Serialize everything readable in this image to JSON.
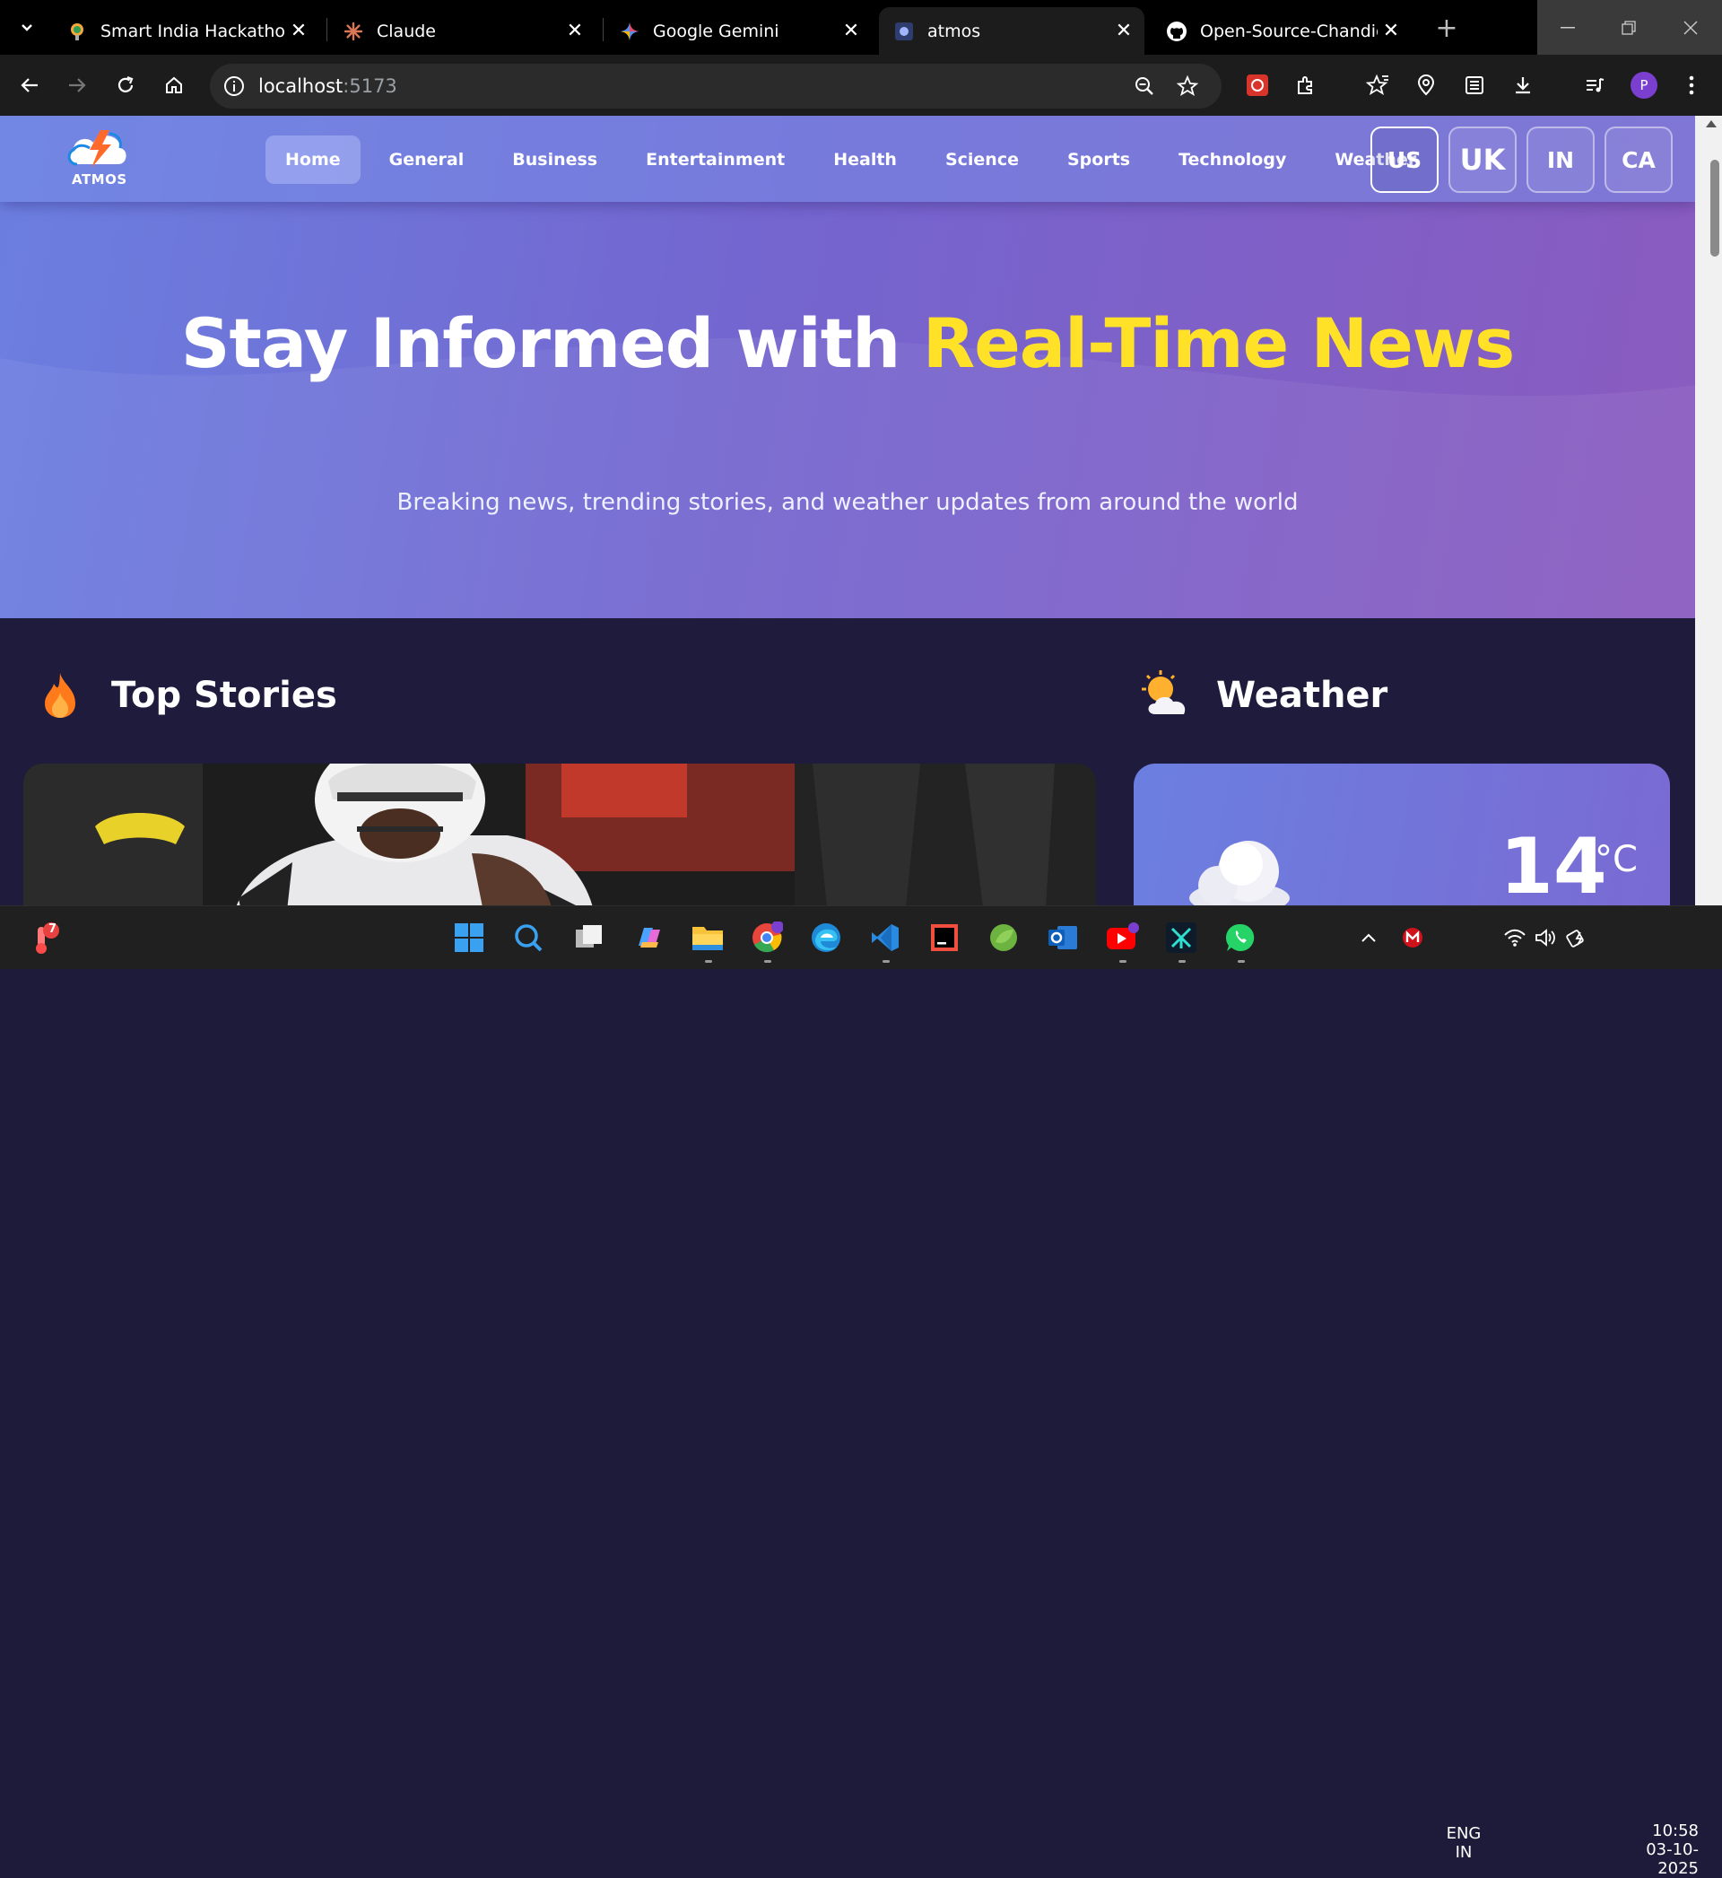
{
  "browser": {
    "tabs": [
      {
        "title": "Smart India Hackathon",
        "icon": "smart-india-hackathon-favicon"
      },
      {
        "title": "Claude",
        "icon": "claude-favicon"
      },
      {
        "title": "Google Gemini",
        "icon": "gemini-favicon"
      },
      {
        "title": "atmos",
        "icon": "atmos-favicon",
        "active": true
      },
      {
        "title": "Open-Source-Chandigarh",
        "icon": "github-favicon"
      }
    ],
    "address": {
      "host": "localhost",
      "port": ":5173"
    },
    "profile_initial": "P"
  },
  "site": {
    "logo_text": "ATMOS",
    "nav": [
      "Home",
      "General",
      "Business",
      "Entertainment",
      "Health",
      "Science",
      "Sports",
      "Technology",
      "Weather"
    ],
    "active_nav": "Home",
    "countries": [
      "US",
      "UK",
      "IN",
      "CA"
    ],
    "selected_country": "US",
    "hero": {
      "title_part1": "Stay Informed with ",
      "title_highlight": "Real-Time News",
      "subtitle": "Breaking news, trending stories, and weather updates from around the world"
    },
    "sections": {
      "top_stories": "Top Stories",
      "weather": "Weather"
    },
    "weather": {
      "temperature": "14",
      "unit": "°C",
      "condition_icon": "cloud-icon"
    }
  },
  "taskbar": {
    "language": "ENG",
    "region": "IN",
    "time": "10:58",
    "date": "03-10-2025",
    "weather_badge": "7"
  }
}
